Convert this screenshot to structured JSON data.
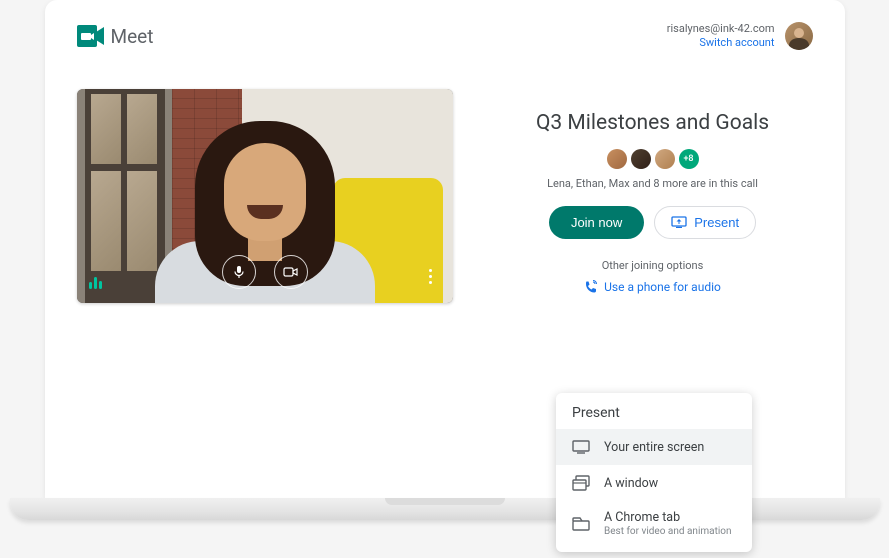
{
  "brand": {
    "name": "Meet"
  },
  "account": {
    "email": "risalynes@ink-42.com",
    "switch_label": "Switch account"
  },
  "meeting": {
    "title": "Q3 Milestones and Goals",
    "participants_text": "Lena, Ethan, Max and 8 more are in this call",
    "more_count": "+8"
  },
  "actions": {
    "join_label": "Join now",
    "present_label": "Present",
    "other_options": "Other joining options",
    "phone_link": "Use a phone for audio"
  },
  "present_menu": {
    "title": "Present",
    "items": [
      {
        "label": "Your entire screen",
        "sub": ""
      },
      {
        "label": "A window",
        "sub": ""
      },
      {
        "label": "A Chrome tab",
        "sub": "Best for video and animation"
      }
    ]
  }
}
